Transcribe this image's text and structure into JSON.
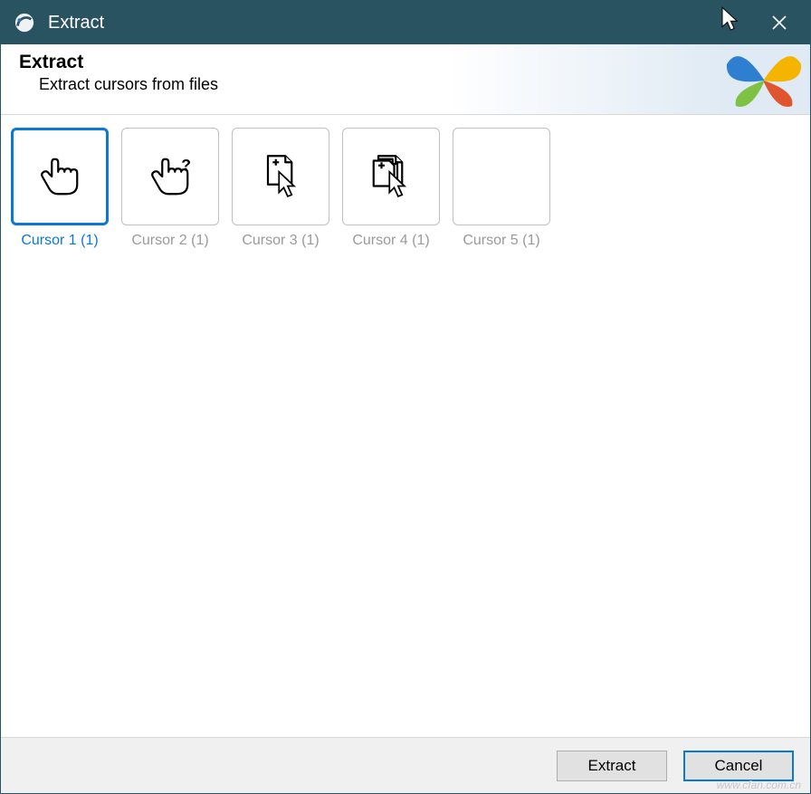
{
  "window": {
    "title": "Extract"
  },
  "header": {
    "title": "Extract",
    "subtitle": "Extract cursors from files"
  },
  "cursors": [
    {
      "label": "Cursor 1 (1)",
      "icon": "hand-link",
      "selected": true
    },
    {
      "label": "Cursor 2 (1)",
      "icon": "hand-help",
      "selected": false
    },
    {
      "label": "Cursor 3 (1)",
      "icon": "doc-arrow",
      "selected": false
    },
    {
      "label": "Cursor 4 (1)",
      "icon": "docs-arrow",
      "selected": false
    },
    {
      "label": "Cursor 5 (1)",
      "icon": "blank",
      "selected": false
    }
  ],
  "footer": {
    "extract_label": "Extract",
    "cancel_label": "Cancel"
  },
  "watermark": "www.cfan.com.cn"
}
